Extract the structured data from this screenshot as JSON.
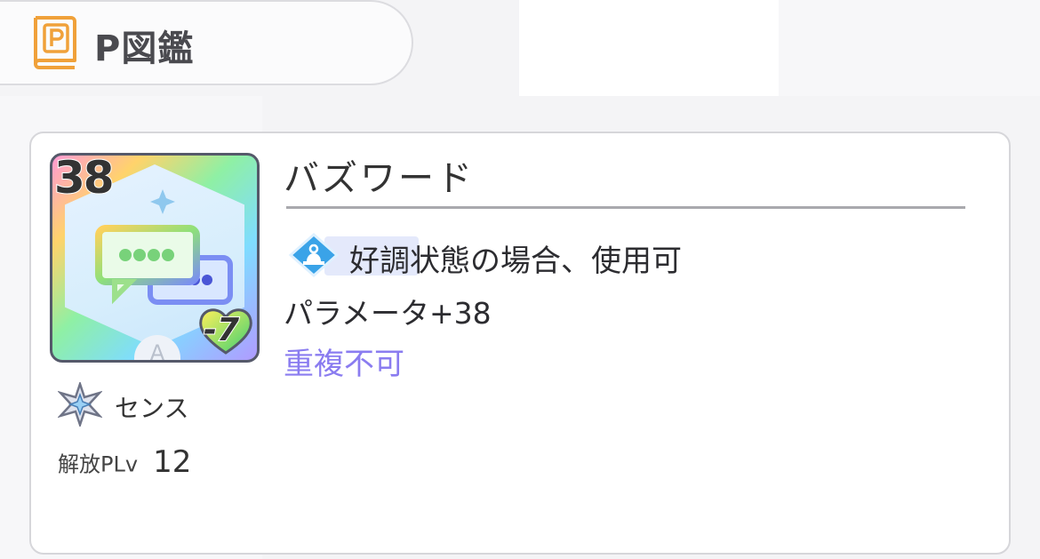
{
  "header": {
    "icon": "book-p-icon",
    "title": "P図鑑"
  },
  "item": {
    "name": "バズワード",
    "thumbnail": {
      "number": "38",
      "heart_value": "-7",
      "rank": "A",
      "icon": "chat-bubbles-icon"
    },
    "type": {
      "icon": "sense-star-icon",
      "label": "センス"
    },
    "unlock": {
      "label": "解放PLv",
      "value": "12"
    },
    "condition": {
      "icon": "good-condition-icon",
      "text": "好調状態の場合、使用可"
    },
    "effect": "パラメータ+38",
    "note": "重複不可"
  },
  "colors": {
    "accent": "#f0a13a",
    "note": "#8a7cf0",
    "condition_highlight": "#e4e9fb"
  }
}
